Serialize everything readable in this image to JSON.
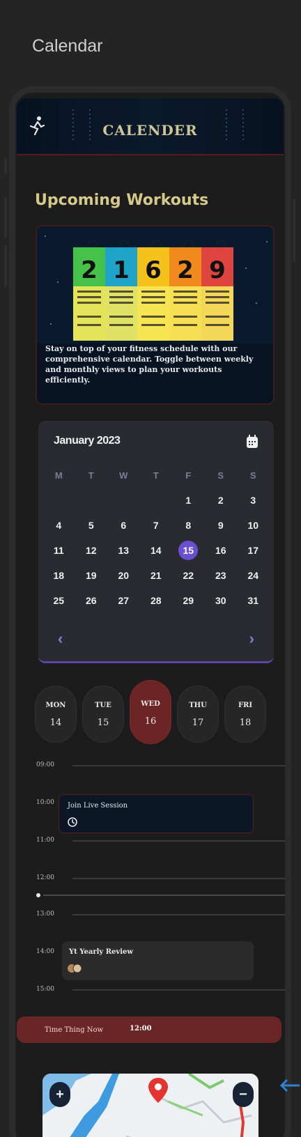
{
  "page": {
    "title": "Calendar"
  },
  "header": {
    "title": "CALENDER"
  },
  "section": {
    "title": "Upcoming Workouts"
  },
  "promo": {
    "image_numbers": [
      "2",
      "1",
      "6",
      "2",
      "9"
    ],
    "description": "Stay on top of your fitness schedule with our comprehensive calendar. Toggle between weekly and monthly views to plan your workouts efficiently."
  },
  "calendar": {
    "month_label": "January 2023",
    "weekdays": [
      "M",
      "T",
      "W",
      "T",
      "F",
      "S",
      "S"
    ],
    "weeks": [
      [
        "",
        "",
        "",
        "",
        "1",
        "2",
        "3"
      ],
      [
        "4",
        "5",
        "6",
        "7",
        "8",
        "9",
        "10"
      ],
      [
        "11",
        "12",
        "13",
        "14",
        "15",
        "16",
        "17"
      ],
      [
        "18",
        "19",
        "20",
        "21",
        "22",
        "23",
        "24"
      ],
      [
        "25",
        "26",
        "27",
        "28",
        "29",
        "30",
        "31"
      ]
    ],
    "selected_day": "15",
    "prev_icon": "chevron-left-icon",
    "next_icon": "chevron-right-icon"
  },
  "day_strip": [
    {
      "name": "MON",
      "num": "14",
      "active": false
    },
    {
      "name": "TUE",
      "num": "15",
      "active": false
    },
    {
      "name": "WED",
      "num": "16",
      "active": true
    },
    {
      "name": "THU",
      "num": "17",
      "active": false
    },
    {
      "name": "FRI",
      "num": "18",
      "active": false
    }
  ],
  "timeline": {
    "hours": [
      "09:00",
      "10:00",
      "11:00",
      "12:00",
      "13:00",
      "14:00",
      "15:00"
    ]
  },
  "events": [
    {
      "title": "Join Live Session",
      "time": "10:00",
      "icon": "timer-icon"
    },
    {
      "title": "Yt Yearly Review",
      "time": "14:00",
      "icon": "avatar-group-icon"
    }
  ],
  "now_bar": {
    "label": "Time Thing Now",
    "time": "12:00"
  },
  "map": {
    "zoom_in_label": "+",
    "zoom_out_label": "−",
    "marker_icon": "map-pin-icon"
  },
  "colors": {
    "accent": "#6a4fd0",
    "highlight": "#6d2424",
    "gold": "#d6c98a"
  }
}
